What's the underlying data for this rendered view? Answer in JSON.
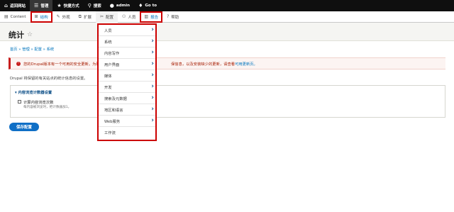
{
  "toolbar": {
    "items": [
      {
        "label": "返回网站",
        "icon": "home-icon"
      },
      {
        "label": "管理",
        "icon": "menu-icon"
      },
      {
        "label": "快捷方式",
        "icon": "star-icon"
      },
      {
        "label": "搜索",
        "icon": "search-icon"
      },
      {
        "label": "admin",
        "icon": "user-icon"
      },
      {
        "label": "Go to",
        "icon": "drupal-icon"
      }
    ]
  },
  "tray": {
    "items": [
      {
        "label": "Content",
        "icon": "content-icon"
      },
      {
        "label": "结构",
        "icon": "structure-icon"
      },
      {
        "label": "外观",
        "icon": "appearance-icon"
      },
      {
        "label": "扩展",
        "icon": "extend-icon"
      },
      {
        "label": "配置",
        "icon": "config-icon"
      },
      {
        "label": "人员",
        "icon": "people-icon"
      },
      {
        "label": "报告",
        "icon": "reports-icon"
      },
      {
        "label": "帮助",
        "icon": "help-icon"
      }
    ]
  },
  "page": {
    "title": "统计",
    "breadcrumb": "首页 » 管理 » 配置 » 系统",
    "alert_text": "您的Drupal版本有一个可用的安全更新。为确",
    "alert_tail": "保信息，以及安装缺少的更新，请查看",
    "alert_link": "可用更新页。",
    "description": "Drupal 将保留的有关站点的统计信息的设置。",
    "fieldset_title": "▾ 内容浏览计数器设置",
    "checkbox_label": "计算内容浏览次数",
    "checkbox_help": "每内容被浏览时，把计数器加1。",
    "save_label": "保存配置"
  },
  "dropdown": {
    "items": [
      {
        "label": "人员",
        "has_submenu": true
      },
      {
        "label": "系统",
        "has_submenu": true
      },
      {
        "label": "内容写作",
        "has_submenu": true
      },
      {
        "label": "用户界面",
        "has_submenu": true
      },
      {
        "label": "媒体",
        "has_submenu": true
      },
      {
        "label": "开发",
        "has_submenu": true
      },
      {
        "label": "搜索及元数据",
        "has_submenu": true
      },
      {
        "label": "地区和语言",
        "has_submenu": true
      },
      {
        "label": "Web服务",
        "has_submenu": true
      },
      {
        "label": "工作流",
        "has_submenu": false
      }
    ]
  },
  "colors": {
    "toolbar_bg": "#0f0f0f",
    "accent": "#0074bd",
    "error": "#c71e1e",
    "highlight_outline": "#cc0000",
    "button": "#0f6fc6"
  }
}
